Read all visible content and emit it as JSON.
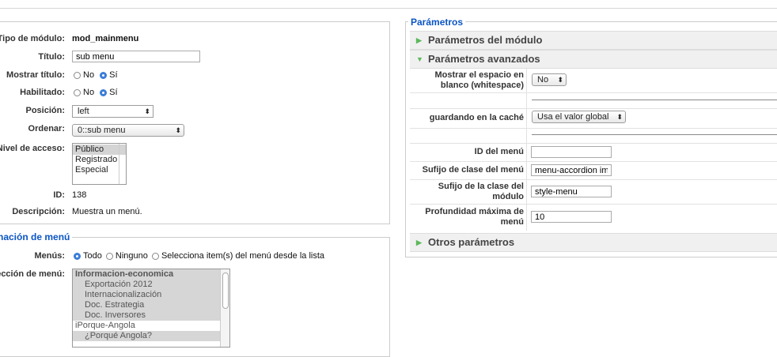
{
  "left": {
    "rows": {
      "tipo_label": "Tipo de módulo:",
      "tipo_value": "mod_mainmenu",
      "titulo_label": "Título:",
      "titulo_value": "sub menu",
      "mostrar_label": "Mostrar título:",
      "habilitado_label": "Habilitado:",
      "no": "No",
      "si": "Sí",
      "posicion_label": "Posición:",
      "posicion_value": "left",
      "ordenar_label": "Ordenar:",
      "ordenar_value": "0::sub menu",
      "nivel_label": "Nivel de acceso:",
      "nivel_options": [
        "Público",
        "Registrado",
        "Especial"
      ],
      "id_label": "ID:",
      "id_value": "138",
      "desc_label": "Descripción:",
      "desc_value": "Muestra un menú."
    },
    "menu_section": {
      "legend": "Asignación de menú",
      "menus_label": "Menús:",
      "todo": "Todo",
      "ninguno": "Ninguno",
      "selecciona": "Selecciona item(s) del menú desde la lista",
      "seleccion_label": "Selección de menú:",
      "items": [
        "Informacion-economica",
        "Exportación 2012",
        "Internacionalización",
        "Doc. Estrategia",
        "Doc. Inversores",
        "iPorque-Angola",
        "¿Porqué Angola?"
      ]
    }
  },
  "right": {
    "legend": "Parámetros",
    "panel_modulo": "Parámetros del módulo",
    "panel_avanzados": "Parámetros avanzados",
    "panel_otros": "Otros parámetros",
    "whitespace_label": "Mostrar el espacio en blanco (whitespace)",
    "whitespace_value": "No",
    "cache_label": "guardando en la caché",
    "cache_value": "Usa el valor global",
    "idmenu_label": "ID del menú",
    "idmenu_value": "",
    "sufijo_clase_menu_label": "Sufijo de clase del menú",
    "sufijo_clase_menu_value": "menu-accordion ima",
    "sufijo_modulo_label": "Sufijo de la clase del módulo",
    "sufijo_modulo_value": "style-menu",
    "profundidad_label": "Profundidad máxima de menú",
    "profundidad_value": "10"
  },
  "colors": {
    "accent": "#0b55c4",
    "triangle": "#5cb85c",
    "radio_on": "#3b7dd8"
  }
}
